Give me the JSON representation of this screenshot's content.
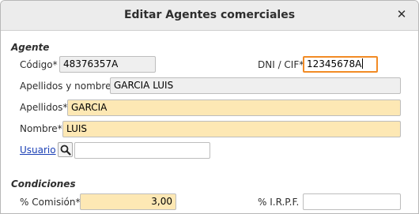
{
  "window": {
    "title": "Editar Agentes comerciales",
    "close_glyph": "✕"
  },
  "agente": {
    "heading": "Agente",
    "codigo_label": "Código*",
    "codigo_value": "48376357A",
    "dni_label": "DNI / CIF*",
    "dni_value": "12345678A",
    "apellidos_nombre_label": "Apellidos y nombre",
    "apellidos_nombre_value": "GARCIA LUIS",
    "apellidos_label": "Apellidos*",
    "apellidos_value": "GARCIA",
    "nombre_label": "Nombre*",
    "nombre_value": "LUIS",
    "usuario_link": "Usuario",
    "usuario_search_icon": "search-icon",
    "usuario_value": ""
  },
  "condiciones": {
    "heading": "Condiciones",
    "comision_label": "% Comisión*",
    "comision_value": "3,00",
    "irpf_label": "% I.R.P.F.",
    "irpf_value": ""
  },
  "colors": {
    "required_bg": "#fde8b4",
    "readonly_bg": "#efefef",
    "focus_border": "#f28b25",
    "link": "#1a3fb5"
  }
}
